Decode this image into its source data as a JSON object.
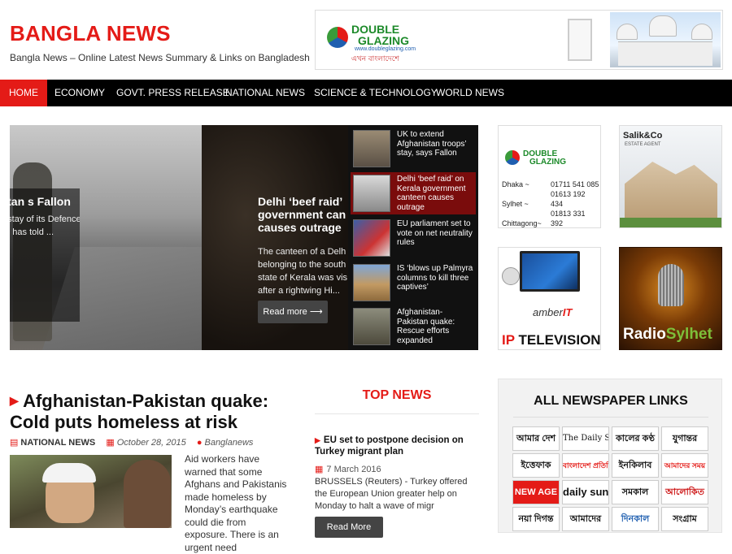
{
  "site": {
    "title": "BANGLA NEWS",
    "description": "Bangla News – Online Latest News Summary & Links on Bangladesh"
  },
  "header_ad": {
    "brand_line1": "DOUBLE",
    "brand_line2": "GLAZING",
    "url": "www.doubleglazing.com",
    "tagline": "এখন বাংলাদেশে"
  },
  "nav": {
    "items": [
      {
        "label": "HOME",
        "active": true
      },
      {
        "label": "ECONOMY"
      },
      {
        "label": "GOVT. PRESS RELEASE"
      },
      {
        "label": "NATIONAL NEWS"
      },
      {
        "label": "SCIENCE & TECHNOLOGY"
      },
      {
        "label": "WORLD NEWS"
      }
    ]
  },
  "slider": {
    "left_partial": {
      "headline": "ghanistan s Fallon",
      "excerpt": "e stay of its Defence on has told ..."
    },
    "main": {
      "headline": "Delhi ‘beef raid’ government can causes outrage",
      "excerpt": "The canteen of a Delh belonging to the south state of Kerala was vis after a rightwing Hi...",
      "read_more": "Read more ⟶"
    },
    "list": [
      {
        "title": "UK to extend Afghanistan troops’ stay, says Fallon"
      },
      {
        "title": "Delhi ‘beef raid’ on Kerala government canteen causes outrage",
        "active": true
      },
      {
        "title": "EU parliament set to vote on net neutrality rules"
      },
      {
        "title": "IS ‘blows up Palmyra columns to kill three captives’"
      },
      {
        "title": "Afghanistan-Pakistan quake: Rescue efforts expanded"
      }
    ]
  },
  "ads": {
    "double": {
      "brand_line1": "DOUBLE",
      "brand_line2": "GLAZING",
      "contacts": [
        {
          "city": "Dhaka ~",
          "phone": "01711 541 085"
        },
        {
          "city": "Sylhet ~",
          "phone": "01613 192 434"
        },
        {
          "city": "Chittagong~",
          "phone": "01813 331 392"
        }
      ]
    },
    "salik": {
      "title": "Salik&Co",
      "sub": "ESTATE AGENT"
    },
    "amber": {
      "brand_a": "amber",
      "brand_b": "IT",
      "iptv_a": "IP",
      "iptv_b": "TELEVISION"
    },
    "radio": {
      "a": "Radi",
      "b": "o",
      "c": "Sylhet"
    }
  },
  "feature": {
    "title": "Afghanistan-Pakistan quake: Cold puts homeless at risk",
    "category": "NATIONAL NEWS",
    "date": "October 28, 2015",
    "author": "Banglanews",
    "excerpt": "Aid workers have warned that some Afghans and Pakistanis made homeless by Monday’s earthquake could die from exposure. There is an urgent need"
  },
  "top_news": {
    "heading": "TOP NEWS",
    "headline": "EU set to postpone decision on Turkey migrant plan",
    "date": "7 March 2016",
    "excerpt": "BRUSSELS (Reuters) - Turkey offered the European Union greater help on Monday to halt a wave of migr",
    "read_more": "Read More"
  },
  "newspapers": {
    "heading": "ALL NEWSPAPER LINKS",
    "logos": [
      "আমার দেশ",
      "The Daily Star",
      "কালের কণ্ঠ",
      "যুগান্তর",
      "ইত্তেফাক",
      "বাংলাদেশ প্রতিদিন",
      "ইনকিলাব",
      "আমাদের সময়",
      "NEW AGE",
      "daily sun",
      "সমকাল",
      "আলোকিত",
      "নয়া দিগন্ত",
      "আমাদের",
      "দিনকাল",
      "সংগ্রাম"
    ]
  },
  "colors": {
    "accent": "#e41b17",
    "nav_bg": "#000000",
    "link_dark": "#111111"
  }
}
